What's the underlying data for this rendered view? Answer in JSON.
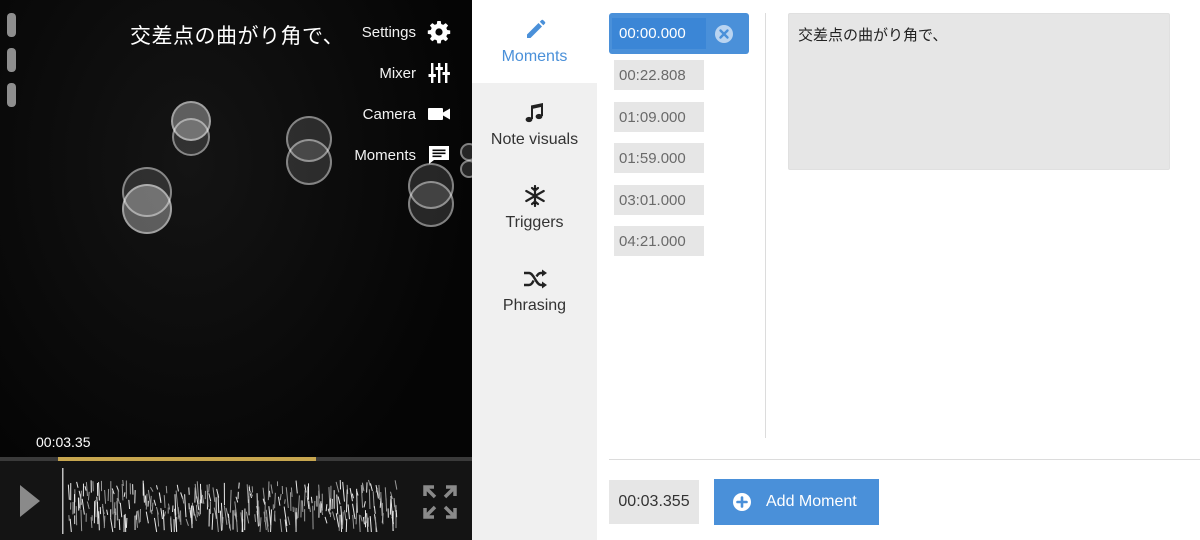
{
  "visualizer": {
    "lyric": "交差点の曲がり角で、",
    "menu": [
      {
        "label": "Settings",
        "icon": "gear-icon"
      },
      {
        "label": "Mixer",
        "icon": "sliders-icon"
      },
      {
        "label": "Camera",
        "icon": "video-camera-icon"
      },
      {
        "label": "Moments",
        "icon": "comment-icon"
      }
    ],
    "timecode": "00:03.35",
    "playback_progress": 0.67,
    "play_icon": "play-icon",
    "fullscreen_icon": "expand-icon"
  },
  "tabs": [
    {
      "label": "Moments",
      "icon": "pencil-icon",
      "active": true
    },
    {
      "label": "Note visuals",
      "icon": "music-note-icon",
      "active": false
    },
    {
      "label": "Triggers",
      "icon": "snowflake-icon",
      "active": false
    },
    {
      "label": "Phrasing",
      "icon": "shuffle-icon",
      "active": false
    }
  ],
  "moments": {
    "selected": "00:00.000",
    "list": [
      "00:22.808",
      "01:09.000",
      "01:59.000",
      "03:01.000",
      "04:21.000"
    ],
    "lyric_text": "交差点の曲がり角で、",
    "current_time": "00:03.355",
    "add_label": "Add Moment"
  },
  "colors": {
    "accent": "#4a90d9",
    "progress": "#c7a64f",
    "visualizer_bg": "#070707",
    "tab_bg": "#f0f0f0"
  }
}
